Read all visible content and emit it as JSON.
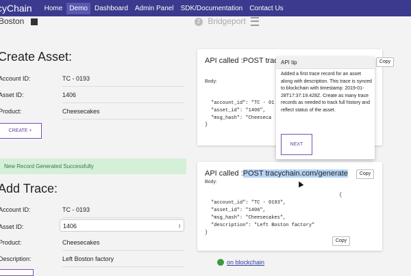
{
  "nav": {
    "brand": "cyChain",
    "items": [
      "Home",
      "Demo",
      "Dashboard",
      "Admin Panel",
      "SDK/Documentation",
      "Contact Us"
    ],
    "active": "Demo"
  },
  "locations": {
    "left": "Boston",
    "right_step": "2",
    "right": "Bridgeport"
  },
  "create": {
    "title": "Create Asset:",
    "fields": [
      {
        "label": "Account ID:",
        "value": "TC - 0193"
      },
      {
        "label": "Asset ID:",
        "value": "1406"
      },
      {
        "label": "Product:",
        "value": "Cheesecakes"
      }
    ],
    "button": "CREATE +"
  },
  "alert": "New Record Generated Successfully",
  "trace": {
    "title": "Add Trace:",
    "fields": [
      {
        "label": "Account ID:",
        "value": "TC - 0193"
      },
      {
        "label": "Asset ID:",
        "value": "1406"
      },
      {
        "label": "Product:",
        "value": "Cheesecakes"
      },
      {
        "label": "Description:",
        "value": "Left Boston factory"
      }
    ]
  },
  "card1": {
    "title": "API called :POST tracy",
    "body_label": "Body:",
    "code": "\"account_id\": \"TC - 01\n\"asset_id\": \"1406\",\n\"msg_hash\": \"Cheeseca",
    "close": "}",
    "copy": "Copy"
  },
  "tip": {
    "title": "API tip",
    "body": "Added a first trace record for an asset along with description. This trace is synced to blockchain with timestamp: 2019-01-28T17:37:19.428Z. Create as many trace records as needed to track full history and reflect status of the asset.",
    "next": "NEXT"
  },
  "card2": {
    "title_prefix": "API called :",
    "title_hl": "POST tracychain.com/generate",
    "body_label": "Body:",
    "open": "{",
    "code": "\"account_id\": \"TC - 0193\",\n\"asset_id\": \"1406\",\n\"msg_hash\": \"Cheesecakes\",\n\"description\": \"Left Boston factory\"",
    "close": "}",
    "copy": "Copy",
    "copy2": "Copy"
  },
  "chain_link": "on blockchain",
  "colors": {
    "nav": "#3b3a8e",
    "accent": "#7b4ab0",
    "success_bg": "#d6efd8",
    "highlight": "#b6d3f5"
  }
}
